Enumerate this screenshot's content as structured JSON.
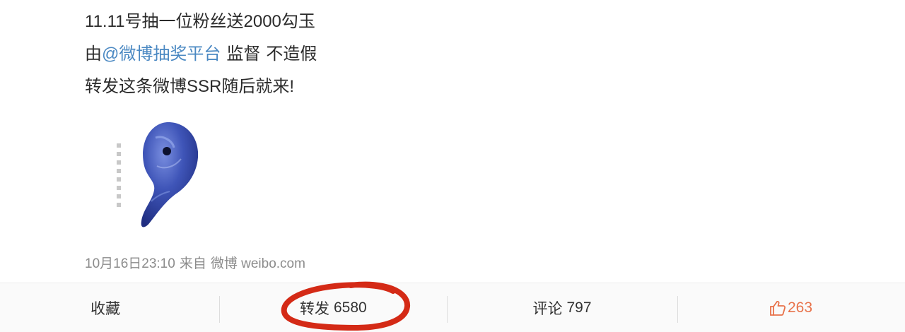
{
  "post": {
    "line1": "11.11号抽一位粉丝送2000勾玉",
    "line2_prefix": "由",
    "line2_mention": "@微博抽奖平台",
    "line2_suffix1": "监督",
    "line2_suffix2": "不造假",
    "line3": "转发这条微博SSR随后就来!",
    "image_icon": "magatama-image"
  },
  "meta": {
    "time": "10月16日23:10",
    "from_label": "来自",
    "source": "微博 weibo.com"
  },
  "actions": {
    "favorite": {
      "label": "收藏"
    },
    "forward": {
      "label": "转发",
      "count": "6580"
    },
    "comment": {
      "label": "评论",
      "count": "797"
    },
    "like": {
      "count": "263",
      "icon": "thumbs-up-icon"
    }
  },
  "colors": {
    "mention": "#4a88c2",
    "like": "#e8724a",
    "annotation": "#d42a16"
  }
}
